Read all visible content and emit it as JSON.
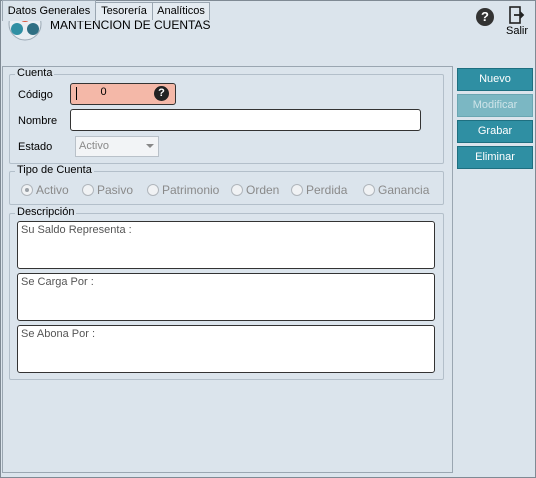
{
  "window": {
    "title": "MANTENCION DE CUENTAS",
    "exit_label": "Salir"
  },
  "tabs": [
    {
      "label": "Datos Generales",
      "active": true
    },
    {
      "label": "Tesorería",
      "active": false
    },
    {
      "label": "Analíticos",
      "active": false
    }
  ],
  "cuenta": {
    "group_title": "Cuenta",
    "codigo_label": "Código",
    "codigo_value": "0",
    "nombre_label": "Nombre",
    "nombre_value": "",
    "estado_label": "Estado",
    "estado_value": "Activo"
  },
  "tipo_cuenta": {
    "group_title": "Tipo de Cuenta",
    "options": [
      {
        "label": "Activo",
        "selected": true
      },
      {
        "label": "Pasivo",
        "selected": false
      },
      {
        "label": "Patrimonio",
        "selected": false
      },
      {
        "label": "Orden",
        "selected": false
      },
      {
        "label": "Perdida",
        "selected": false
      },
      {
        "label": "Ganancia",
        "selected": false
      }
    ]
  },
  "descripcion": {
    "group_title": "Descripción",
    "saldo_placeholder": "Su Saldo Representa :",
    "carga_placeholder": "Se Carga Por :",
    "abona_placeholder": "Se Abona Por :"
  },
  "actions": {
    "nuevo": "Nuevo",
    "modificar": "Modificar",
    "grabar": "Grabar",
    "eliminar": "Eliminar"
  },
  "colors": {
    "background": "#dbe4ec",
    "button": "#2f8fa3",
    "button_disabled": "#7bb7c3",
    "codigo_field": "#f4b8a8"
  }
}
